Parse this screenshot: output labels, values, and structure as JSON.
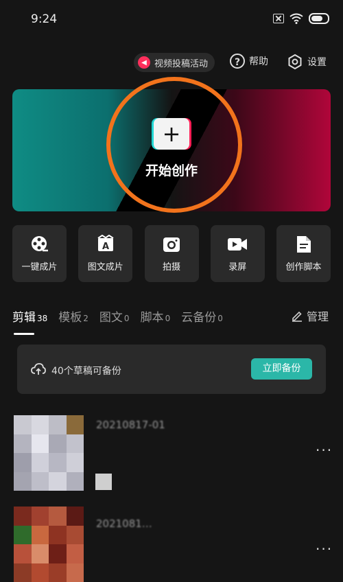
{
  "status": {
    "time": "9:24"
  },
  "top": {
    "promo_label": "视频投稿活动",
    "help_label": "帮助",
    "settings_label": "设置"
  },
  "banner": {
    "create_label": "开始创作"
  },
  "tools": [
    {
      "label": "一键成片",
      "icon": "film-reel-icon"
    },
    {
      "label": "图文成片",
      "icon": "text-card-icon"
    },
    {
      "label": "拍摄",
      "icon": "camera-icon"
    },
    {
      "label": "录屏",
      "icon": "video-record-icon"
    },
    {
      "label": "创作脚本",
      "icon": "document-icon"
    }
  ],
  "tabs": [
    {
      "label": "剪辑",
      "count": "38"
    },
    {
      "label": "模板",
      "count": "2"
    },
    {
      "label": "图文",
      "count": "0"
    },
    {
      "label": "脚本",
      "count": "0"
    },
    {
      "label": "云备份",
      "count": "0"
    }
  ],
  "manage_label": "管理",
  "backup": {
    "text": "40个草稿可备份",
    "button": "立即备份"
  },
  "drafts": [
    {
      "title": "20210817-01",
      "more": "···"
    },
    {
      "title": "2021081…",
      "more": "···"
    }
  ],
  "colors": {
    "accent": "#2bb7a8",
    "highlight_ring": "#f2731c"
  }
}
